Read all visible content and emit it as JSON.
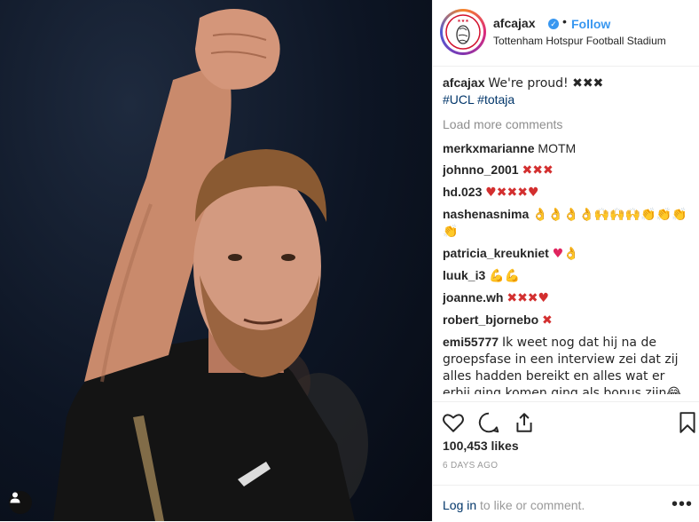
{
  "post": {
    "username": "afcajax",
    "verified_mark": "✓",
    "dot": "•",
    "follow_label": "Follow",
    "location": "Tottenham Hotspur Football Stadium"
  },
  "caption": {
    "user": "afcajax",
    "text": "We're proud! ✖✖✖",
    "hashtags": "#UCL #totaja"
  },
  "load_more": "Load more comments",
  "comments": [
    {
      "user": "merkxmarianne",
      "text": "MOTM"
    },
    {
      "user": "johnno_2001",
      "text": "✖✖✖"
    },
    {
      "user": "hd.023",
      "text": "♥✖✖✖♥"
    },
    {
      "user": "nashenasnima",
      "text": "👌👌👌👌🙌🙌🙌👏👏👏👏"
    },
    {
      "user": "patricia_kreukniet",
      "text": "♥👌"
    },
    {
      "user": "luuk_i3",
      "text": "💪💪"
    },
    {
      "user": "joanne.wh",
      "text": "✖✖✖♥"
    },
    {
      "user": "robert_bjornebo",
      "text": "✖"
    },
    {
      "user": "emi55777",
      "text": "Ik weet nog dat hij na de groepsfase in een interview zei dat zij alles hadden bereikt en alles wat er erbij ging komen ging als bonus zijn😂😂😂"
    }
  ],
  "likes": "100,453 likes",
  "time_ago": "6 DAYS AGO",
  "footer": {
    "login_link": "Log in",
    "login_rest": " to like or comment.",
    "more": "•••"
  },
  "icons": {
    "heart": "heart-icon",
    "comment": "comment-icon",
    "share": "share-icon",
    "bookmark": "bookmark-icon",
    "tag": "user-tag-icon"
  },
  "colors": {
    "link_blue": "#3897f0",
    "hashtag": "#003569",
    "muted": "#8e8e8e"
  }
}
